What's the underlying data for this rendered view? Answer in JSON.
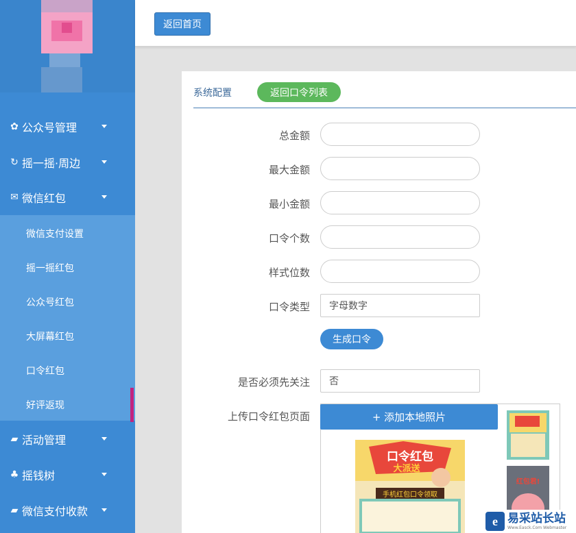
{
  "sidebar": {
    "menu": [
      {
        "icon": "gear-icon",
        "glyph": "✿",
        "label": "公众号管理"
      },
      {
        "icon": "refresh-icon",
        "glyph": "↻",
        "label": "摇一摇·周边"
      },
      {
        "icon": "envelope-icon",
        "glyph": "✉",
        "label": "微信红包"
      }
    ],
    "submenu": [
      {
        "label": "微信支付设置"
      },
      {
        "label": "摇一摇红包"
      },
      {
        "label": "公众号红包"
      },
      {
        "label": "大屏幕红包"
      },
      {
        "label": "口令红包"
      },
      {
        "label": "好评返现"
      }
    ],
    "menu_bottom": [
      {
        "icon": "folder-open-icon",
        "glyph": "▰",
        "label": "活动管理"
      },
      {
        "icon": "tree-icon",
        "glyph": "♣",
        "label": "摇钱树"
      },
      {
        "icon": "folder-open-icon",
        "glyph": "▰",
        "label": "微信支付收款"
      }
    ],
    "active_sub": "好评返现"
  },
  "topbar": {
    "home_button": "返回首页"
  },
  "panel": {
    "title": "系统配置",
    "back_button": "返回口令列表",
    "fields": {
      "total_amount": {
        "label": "总金额",
        "value": ""
      },
      "max_amount": {
        "label": "最大金额",
        "value": ""
      },
      "min_amount": {
        "label": "最小金额",
        "value": ""
      },
      "code_count": {
        "label": "口令个数",
        "value": ""
      },
      "style_digits": {
        "label": "样式位数",
        "value": ""
      },
      "code_type": {
        "label": "口令类型",
        "value": "字母数字"
      },
      "must_follow": {
        "label": "是否必须先关注",
        "value": "否"
      },
      "upload_page": {
        "label": "上传口令红包页面"
      }
    },
    "generate_button": "生成口令",
    "upload_button": "+ 添加本地照片",
    "thumbnail_text": {
      "main_title": "口令红包",
      "main_sub": "大派送",
      "main_banner": "手机红包口令领取",
      "small2_text": "红包君!"
    }
  },
  "watermark": {
    "logo": "e",
    "cn": "易采站长站",
    "en": "Www.Easck.Com Webmaster"
  },
  "colors": {
    "sidebar": "#3d8ad4",
    "submenu": "#5a9fde",
    "accent_green": "#5cb85c",
    "active_bar": "#c2247f"
  }
}
